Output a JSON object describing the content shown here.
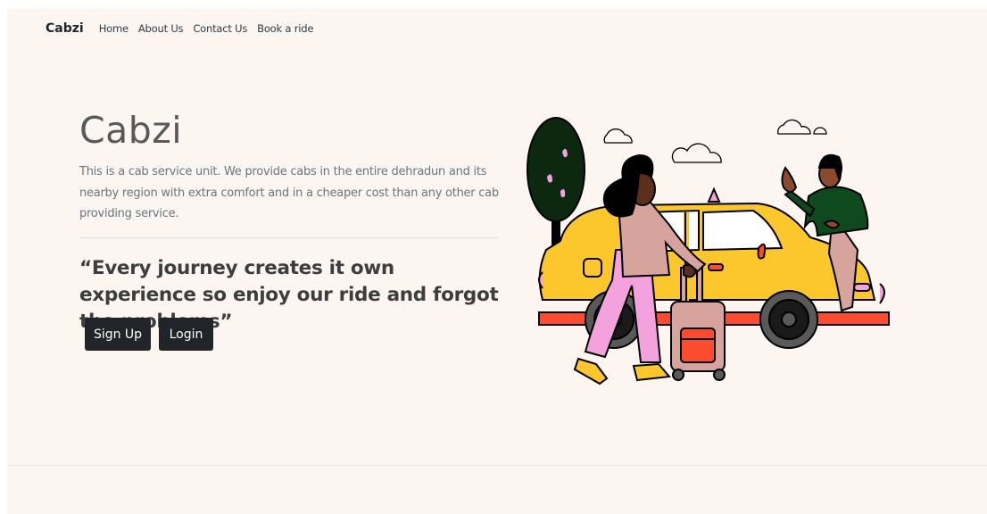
{
  "navbar": {
    "brand": "Cabzi",
    "links": [
      "Home",
      "About Us",
      "Contact Us",
      "Book a ride"
    ]
  },
  "hero": {
    "title": "Cabzi",
    "description": "This is a cab service unit. We provide cabs in the entire dehradun and its nearby region with extra comfort and in a cheaper cost than any other cab providing service.",
    "quote": "“Every journey creates it own experience so enjoy our ride and forgot the problems”",
    "buttons": {
      "signup": "Sign Up",
      "login": "Login"
    }
  },
  "illustration": {
    "subject": "taxi-illustration",
    "colors": {
      "taxi": "#fcc72c",
      "pink": "#f3a2dd",
      "tree": "#0c2910",
      "sweater": "#0f4a1f",
      "luggage": "#d6a49c",
      "red": "#fb4c2f",
      "outline": "#000000"
    }
  }
}
